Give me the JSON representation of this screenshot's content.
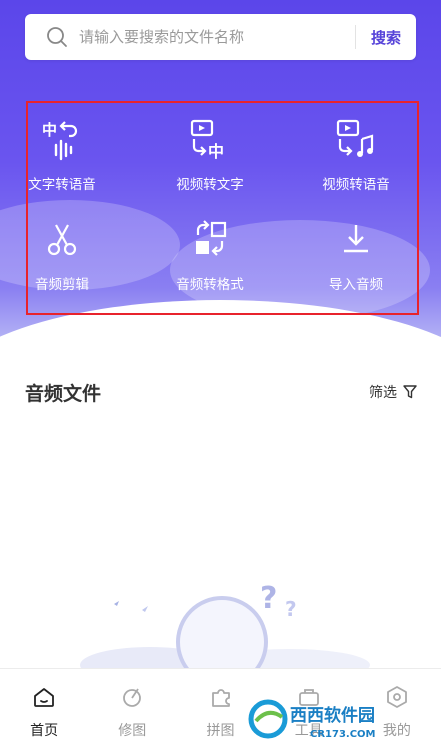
{
  "search": {
    "placeholder": "请输入要搜索的文件名称",
    "button_label": "搜索"
  },
  "tools": [
    {
      "label": "文字转语音",
      "icon": "text-to-speech-icon"
    },
    {
      "label": "视频转文字",
      "icon": "video-to-text-icon"
    },
    {
      "label": "视频转语音",
      "icon": "video-to-audio-icon"
    },
    {
      "label": "音频剪辑",
      "icon": "scissors-icon"
    },
    {
      "label": "音频转格式",
      "icon": "format-convert-icon"
    },
    {
      "label": "导入音频",
      "icon": "import-icon"
    }
  ],
  "section": {
    "title": "音频文件",
    "filter_label": "筛选",
    "filter_icon": "filter-icon"
  },
  "tabbar": [
    {
      "label": "首页",
      "icon": "home-icon",
      "active": true
    },
    {
      "label": "修图",
      "icon": "edit-photo-icon",
      "active": false
    },
    {
      "label": "拼图",
      "icon": "puzzle-icon",
      "active": false
    },
    {
      "label": "工具",
      "icon": "toolbox-icon",
      "active": false
    },
    {
      "label": "我的",
      "icon": "profile-icon",
      "active": false
    }
  ],
  "watermark": {
    "brand": "西西软件园",
    "url": "CR173.COM"
  },
  "colors": {
    "accent": "#5643d9",
    "highlight_border": "#e8232c"
  }
}
